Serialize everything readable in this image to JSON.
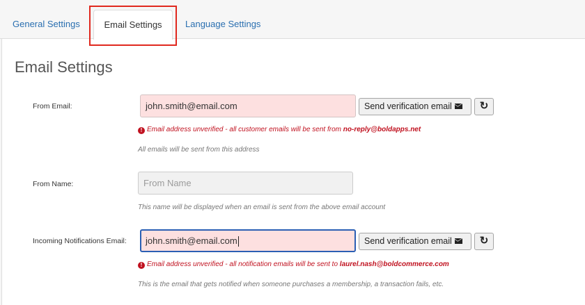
{
  "tabs": {
    "general": "General Settings",
    "email": "Email Settings",
    "language": "Language Settings"
  },
  "page_title": "Email Settings",
  "from_email": {
    "label": "From Email:",
    "value": "john.smith@email.com",
    "button": "Send verification email",
    "error_prefix": "Email address unverified - all customer emails will be sent from ",
    "error_email": "no-reply@boldapps.net",
    "help": "All emails will be sent from this address"
  },
  "from_name": {
    "label": "From Name:",
    "placeholder": "From Name",
    "help": "This name will be displayed when an email is sent from the above email account"
  },
  "notifications_email": {
    "label": "Incoming Notifications Email:",
    "value": "john.smith@email.com",
    "button": "Send verification email",
    "error_prefix": "Email address unverified - all notification emails will be sent to ",
    "error_email": "laurel.nash@boldcommerce.com",
    "help": "This is the email that gets notified when someone purchases a membership, a transaction fails, etc."
  },
  "icons": {
    "mail": "envelope-icon",
    "refresh": "refresh-icon",
    "error": "exclamation-circle-icon"
  },
  "colors": {
    "link": "#2a6fb0",
    "error": "#c0111f",
    "input_error_bg": "#fde0e0",
    "focus_border": "#2b5fb4",
    "highlight": "#e0281e"
  }
}
